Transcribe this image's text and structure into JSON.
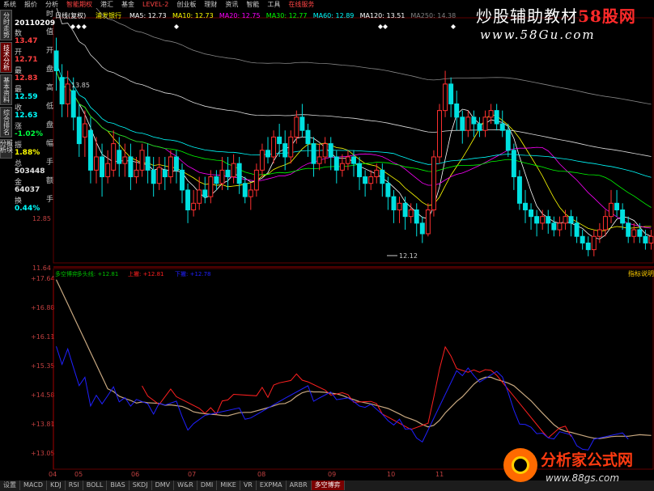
{
  "menu": [
    "系统",
    "报价",
    "分析",
    "智能期权",
    "港汇",
    "基金",
    "LEVEL-2",
    "创业板",
    "理财",
    "资讯",
    "智能",
    "工具",
    "在线服务"
  ],
  "menu_highlight": [
    "智能期权",
    "LEVEL-2",
    "在线服务"
  ],
  "left_tabs": [
    "分时走势",
    "技术分析",
    "基本资料",
    "综合排名",
    "板块分析"
  ],
  "left_tab_active": 1,
  "info": {
    "time_label": "时",
    "date": "20110209",
    "rows": [
      {
        "k": "值",
        "v": "13.47",
        "c": "#ff4040"
      },
      {
        "k": "开",
        "v": "12.71",
        "c": "#ff4040"
      },
      {
        "k": "盘",
        "v": "12.83",
        "c": "#ff4040"
      },
      {
        "k": "高",
        "v": "12.59",
        "c": "#00ffff"
      },
      {
        "k": "低",
        "v": "12.63",
        "c": "#00ffff"
      },
      {
        "k": "盘",
        "v": "-1.02%",
        "c": "#00ff40"
      },
      {
        "k": "幅",
        "v": "1.88%",
        "c": "#ffff00"
      },
      {
        "k": "手",
        "v": "503448",
        "c": "#e0e0e0"
      },
      {
        "k": "额",
        "v": "64037",
        "c": "#e0e0e0"
      },
      {
        "k": "手",
        "v": "0.44%",
        "c": "#00ffff"
      }
    ],
    "left_words": [
      "数",
      "开",
      "最",
      "最",
      "收",
      "涨",
      "振",
      "总",
      "金",
      "换"
    ]
  },
  "legend": {
    "period": "日线(复权)",
    "stock": "浦发银行",
    "ma": [
      {
        "label": "MA5: 12.73",
        "color": "#ffffff"
      },
      {
        "label": "MA10: 12.73",
        "color": "#ffff00"
      },
      {
        "label": "MA20: 12.75",
        "color": "#ff00ff"
      },
      {
        "label": "MA30: 12.77",
        "color": "#00ff00"
      },
      {
        "label": "MA60: 12.89",
        "color": "#00ffff"
      },
      {
        "label": "MA120: 13.51",
        "color": "#ffffff"
      },
      {
        "label": "MA250: 14.38",
        "color": "#808080"
      }
    ]
  },
  "price_axis": [
    "12.85",
    "11.64"
  ],
  "top_annotations": {
    "peak": "13.85",
    "low": "12.12"
  },
  "indicator": {
    "name": "多空博弈",
    "values": [
      {
        "label": "多空博弈",
        "color": "#00c000"
      },
      {
        "label": "多头线: +12.81",
        "color": "#00c000"
      },
      {
        "label": "上撇: +12.81",
        "color": "#ff2020"
      },
      {
        "label": "下撇: +12.78",
        "color": "#2020ff"
      }
    ],
    "axis": [
      "+17.64",
      "+16.88",
      "+16.11",
      "+15.35",
      "+14.58",
      "+13.81",
      "+13.05"
    ],
    "corner_label": "指标说明"
  },
  "xaxis": [
    "04",
    "05",
    "06",
    "07",
    "08",
    "09",
    "10",
    "11"
  ],
  "bottom_tabs": [
    "设置",
    "MACD",
    "KDJ",
    "RSI",
    "BOLL",
    "BIAS",
    "SKDJ",
    "DMV",
    "W&R",
    "DMI",
    "MIKE",
    "VR",
    "EXPMA",
    "ARBR",
    "多空博弈"
  ],
  "bottom_tab_active": 14,
  "watermark": {
    "text": "炒股辅助教材",
    "brand": "58股网",
    "url": "www.58Gu.com"
  },
  "logo": {
    "brand": "分析家公式网",
    "url": "www.88gs.com"
  },
  "chart_data": {
    "type": "candlestick",
    "up_color": "#ff3030",
    "down_color": "#00e0e0",
    "candles": [
      [
        13.5,
        13.35,
        13.6,
        13.2
      ],
      [
        13.3,
        13.1,
        13.4,
        13.0
      ],
      [
        13.1,
        13.25,
        13.35,
        13.0
      ],
      [
        13.2,
        13.0,
        13.3,
        12.9
      ],
      [
        13.0,
        12.8,
        13.1,
        12.7
      ],
      [
        12.85,
        12.95,
        13.05,
        12.7
      ],
      [
        12.9,
        12.6,
        13.0,
        12.5
      ],
      [
        12.6,
        12.7,
        12.85,
        12.5
      ],
      [
        12.7,
        12.55,
        12.8,
        12.4
      ],
      [
        12.55,
        12.65,
        12.75,
        12.5
      ],
      [
        12.6,
        12.8,
        12.9,
        12.55
      ],
      [
        12.75,
        12.65,
        12.85,
        12.55
      ],
      [
        12.65,
        12.7,
        12.8,
        12.55
      ],
      [
        12.7,
        12.55,
        12.8,
        12.45
      ],
      [
        12.55,
        12.6,
        12.7,
        12.5
      ],
      [
        12.6,
        12.75,
        12.8,
        12.55
      ],
      [
        12.7,
        12.6,
        12.8,
        12.5
      ],
      [
        12.6,
        12.5,
        12.7,
        12.4
      ],
      [
        12.5,
        12.62,
        12.7,
        12.45
      ],
      [
        12.6,
        12.55,
        12.7,
        12.45
      ],
      [
        12.55,
        12.7,
        12.75,
        12.5
      ],
      [
        12.7,
        12.6,
        12.75,
        12.5
      ],
      [
        12.6,
        12.45,
        12.65,
        12.35
      ],
      [
        12.45,
        12.3,
        12.5,
        12.2
      ],
      [
        12.3,
        12.35,
        12.45,
        12.25
      ],
      [
        12.35,
        12.45,
        12.55,
        12.3
      ],
      [
        12.45,
        12.4,
        12.55,
        12.35
      ],
      [
        12.4,
        12.55,
        12.6,
        12.35
      ],
      [
        12.55,
        12.5,
        12.6,
        12.45
      ],
      [
        12.5,
        12.6,
        12.7,
        12.45
      ],
      [
        12.6,
        12.55,
        12.7,
        12.45
      ],
      [
        12.55,
        12.65,
        12.72,
        12.5
      ],
      [
        12.65,
        12.5,
        12.7,
        12.42
      ],
      [
        12.5,
        12.4,
        12.55,
        12.35
      ],
      [
        12.4,
        12.45,
        12.5,
        12.3
      ],
      [
        12.45,
        12.6,
        12.65,
        12.4
      ],
      [
        12.6,
        12.75,
        12.8,
        12.55
      ],
      [
        12.75,
        12.7,
        12.85,
        12.65
      ],
      [
        12.7,
        12.85,
        12.9,
        12.65
      ],
      [
        12.85,
        12.8,
        12.95,
        12.7
      ],
      [
        12.8,
        12.7,
        12.9,
        12.6
      ],
      [
        12.7,
        12.85,
        12.9,
        12.65
      ],
      [
        12.85,
        13.0,
        13.05,
        12.8
      ],
      [
        13.0,
        12.9,
        13.1,
        12.85
      ],
      [
        12.9,
        12.8,
        12.95,
        12.7
      ],
      [
        12.8,
        12.65,
        12.85,
        12.55
      ],
      [
        12.65,
        12.7,
        12.8,
        12.6
      ],
      [
        12.7,
        12.8,
        12.85,
        12.65
      ],
      [
        12.8,
        12.7,
        12.85,
        12.6
      ],
      [
        12.7,
        12.6,
        12.75,
        12.5
      ],
      [
        12.6,
        12.65,
        12.72,
        12.55
      ],
      [
        12.65,
        12.7,
        12.75,
        12.6
      ],
      [
        12.7,
        12.65,
        12.75,
        12.55
      ],
      [
        12.65,
        12.55,
        12.7,
        12.45
      ],
      [
        12.55,
        12.5,
        12.6,
        12.4
      ],
      [
        12.5,
        12.55,
        12.6,
        12.45
      ],
      [
        12.55,
        12.6,
        12.65,
        12.5
      ],
      [
        12.6,
        12.5,
        12.65,
        12.4
      ],
      [
        12.5,
        12.4,
        12.55,
        12.3
      ],
      [
        12.4,
        12.3,
        12.45,
        12.2
      ],
      [
        12.3,
        12.35,
        12.4,
        12.2
      ],
      [
        12.35,
        12.25,
        12.4,
        12.15
      ],
      [
        12.25,
        12.3,
        12.35,
        12.2
      ],
      [
        12.3,
        12.2,
        12.35,
        12.1
      ],
      [
        12.2,
        12.12,
        12.25,
        12.05
      ],
      [
        12.12,
        12.3,
        12.35,
        12.1
      ],
      [
        12.3,
        12.7,
        12.75,
        12.25
      ],
      [
        12.7,
        13.05,
        13.1,
        12.65
      ],
      [
        13.05,
        13.25,
        13.35,
        13.0
      ],
      [
        13.25,
        13.1,
        13.3,
        13.0
      ],
      [
        13.1,
        13.0,
        13.2,
        12.9
      ],
      [
        13.0,
        12.9,
        13.05,
        12.8
      ],
      [
        12.9,
        13.0,
        13.05,
        12.85
      ],
      [
        13.0,
        12.95,
        13.05,
        12.85
      ],
      [
        12.95,
        12.9,
        13.0,
        12.85
      ],
      [
        12.9,
        13.0,
        13.05,
        12.85
      ],
      [
        13.0,
        13.05,
        13.1,
        12.95
      ],
      [
        13.05,
        12.95,
        13.1,
        12.9
      ],
      [
        12.95,
        12.9,
        13.05,
        12.85
      ],
      [
        12.9,
        12.75,
        12.95,
        12.7
      ],
      [
        12.75,
        12.55,
        12.8,
        12.45
      ],
      [
        12.55,
        12.35,
        12.6,
        12.3
      ],
      [
        12.35,
        12.3,
        12.45,
        12.2
      ],
      [
        12.3,
        12.25,
        12.35,
        12.15
      ],
      [
        12.25,
        12.2,
        12.3,
        12.1
      ],
      [
        12.2,
        12.25,
        12.3,
        12.15
      ],
      [
        12.25,
        12.2,
        12.3,
        12.12
      ],
      [
        12.2,
        12.15,
        12.25,
        12.1
      ],
      [
        12.15,
        12.2,
        12.25,
        12.1
      ],
      [
        12.2,
        12.25,
        12.3,
        12.15
      ],
      [
        12.25,
        12.2,
        12.3,
        12.1
      ],
      [
        12.2,
        12.1,
        12.25,
        12.05
      ],
      [
        12.1,
        12.05,
        12.15,
        12.0
      ],
      [
        12.05,
        12.0,
        12.1,
        11.95
      ],
      [
        12.0,
        12.1,
        12.15,
        11.95
      ],
      [
        12.1,
        12.15,
        12.2,
        12.05
      ],
      [
        12.15,
        12.25,
        12.3,
        12.1
      ],
      [
        12.25,
        12.35,
        12.45,
        12.2
      ],
      [
        12.35,
        12.3,
        12.45,
        12.25
      ],
      [
        12.3,
        12.2,
        12.35,
        12.15
      ],
      [
        12.2,
        12.1,
        12.25,
        12.05
      ],
      [
        12.1,
        12.15,
        12.2,
        12.05
      ],
      [
        12.15,
        12.1,
        12.2,
        12.05
      ],
      [
        12.1,
        12.05,
        12.15,
        12.0
      ],
      [
        12.05,
        12.1,
        12.15,
        12.0
      ]
    ],
    "indicator_series": [
      {
        "name": "多空博弈",
        "color": "#c8a880"
      },
      {
        "name": "上撇",
        "color": "#ff2020"
      },
      {
        "name": "下撇",
        "color": "#2020ff"
      }
    ]
  }
}
